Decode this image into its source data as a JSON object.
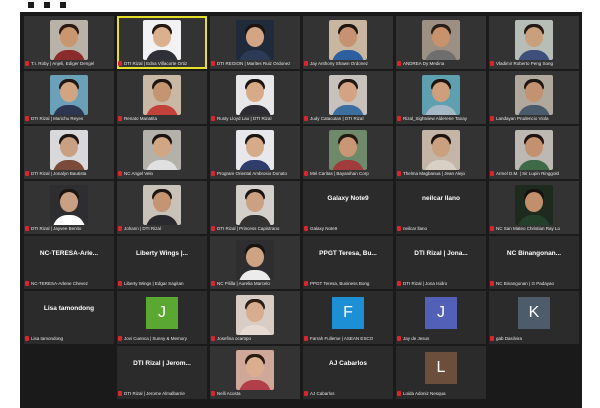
{
  "colors": {
    "active_border": "#e6df2a",
    "muted_mic": "#d8262e",
    "tile_bg": "#2b2b2b"
  },
  "icons": {
    "muted_mic": "mic-muted-icon"
  },
  "participants": [
    {
      "label": "T.I. Roby | Anjeli, Ediger Dengel",
      "type": "video",
      "photo": {
        "bg": "#b9b2a9",
        "skin": "#c9976f",
        "hair": "#2a1a12",
        "shirt": "#8a2c2c"
      }
    },
    {
      "label": "DTI Rizal | Edna Villacorte Ortiz",
      "type": "video",
      "active": true,
      "photo": {
        "bg": "#f2f2f4",
        "skin": "#dcb08f",
        "hair": "#241812",
        "shirt": "#2f2f38"
      }
    },
    {
      "label": "DTI REGION | Marites Ruiz Ordonez",
      "type": "video",
      "photo": {
        "bg": "#1f2a3a",
        "skin": "#d4a584",
        "hair": "#1c1410",
        "shirt": "#2b3b55"
      }
    },
    {
      "label": "Jay Anthony Shawn Ordonez",
      "type": "video",
      "photo": {
        "bg": "#c9b6a0",
        "skin": "#c69271",
        "hair": "#1e1511",
        "shirt": "#2d5fa0"
      }
    },
    {
      "label": "ANDREA Dy Medina",
      "type": "video",
      "photo": {
        "bg": "#9c8f84",
        "skin": "#c8926c",
        "hair": "#2a1f18",
        "shirt": "#6e6e6e"
      }
    },
    {
      "label": "Vladimir Roberto Peng Song",
      "type": "video",
      "photo": {
        "bg": "#b7beb8",
        "skin": "#caa07c",
        "hair": "#241a14",
        "shirt": "#3d4f7a"
      }
    },
    {
      "label": "DTI Rizal | Marichu Reyes",
      "type": "video",
      "photo": {
        "bg": "#6aa0b8",
        "skin": "#d2a582",
        "hair": "#201612",
        "shirt": "#2c3650"
      }
    },
    {
      "label": "Renato Manatita",
      "type": "video",
      "photo": {
        "bg": "#c8b8a4",
        "skin": "#c59470",
        "hair": "#1c140f",
        "shirt": "#c2423a"
      }
    },
    {
      "label": "Rusty Lloyd Lao | DTI Rizal",
      "type": "video",
      "photo": {
        "bg": "#e7e7ea",
        "skin": "#d8ab88",
        "hair": "#1c1410",
        "shirt": "#2c2c32"
      }
    },
    {
      "label": "Judy Catacutan | DTI Rizal",
      "type": "video",
      "photo": {
        "bg": "#c7c2bc",
        "skin": "#d3a384",
        "hair": "#211711",
        "shirt": "#3c6ea0"
      }
    },
    {
      "label": "Rizal_Sightview Alderene Tanay",
      "type": "video",
      "photo": {
        "bg": "#5e9fb0",
        "skin": "#cf9f7b",
        "hair": "#1d1410",
        "shirt": "#a4b8c6"
      }
    },
    {
      "label": "Landayan Prudencio Viola",
      "type": "video",
      "photo": {
        "bg": "#b0a79d",
        "skin": "#c39270",
        "hair": "#1f1611",
        "shirt": "#4a5a6b"
      }
    },
    {
      "label": "DTI Rizal | Jonalyn Bautista",
      "type": "video",
      "photo": {
        "bg": "#d9d9dc",
        "skin": "#caa083",
        "hair": "#1e1612",
        "shirt": "#7a4a3a"
      }
    },
    {
      "label": "NC Angel Velo",
      "type": "video",
      "photo": {
        "bg": "#b4b1ab",
        "skin": "#d1a684",
        "hair": "#1a1310",
        "shirt": "#e0e0e0"
      }
    },
    {
      "label": "Program Oriental Ambrosio Donato",
      "type": "video",
      "photo": {
        "bg": "#e8e8ec",
        "skin": "#d6ab8a",
        "hair": "#1d1512",
        "shirt": "#2e3e6a"
      }
    },
    {
      "label": "Mel Caritas | Bayanihan Corp",
      "type": "video",
      "photo": {
        "bg": "#6f8a6a",
        "skin": "#c99775",
        "hair": "#211812",
        "shirt": "#a13c3c"
      }
    },
    {
      "label": "Thelma Magbanua | Jean Alejo",
      "type": "video",
      "photo": {
        "bg": "#c4b5a6",
        "skin": "#caa07f",
        "hair": "#1c1410",
        "shirt": "#d8d0c4"
      }
    },
    {
      "label": "Armel D.M. | Sir Lupin Ringgold",
      "type": "video",
      "photo": {
        "bg": "#bdb9b2",
        "skin": "#c49170",
        "hair": "#1e1511",
        "shirt": "#3f6a48"
      }
    },
    {
      "label": "DTI Rizal | Jayvee Benito",
      "type": "video",
      "photo": {
        "bg": "#2e2e30",
        "skin": "#caa084",
        "hair": "#1b1410",
        "shirt": "#ffffff"
      }
    },
    {
      "label": "Johann | DTI Rizal",
      "type": "video",
      "photo": {
        "bg": "#c9c2b8",
        "skin": "#c59573",
        "hair": "#1d1511",
        "shirt": "#2a2a2e"
      }
    },
    {
      "label": "DTI Rizal | Princess Capistrano",
      "type": "video",
      "photo": {
        "bg": "#d3d0cb",
        "skin": "#cba083",
        "hair": "#1b1410",
        "shirt": "#323232"
      }
    },
    {
      "label": "Galaxy Note9",
      "type": "name",
      "name": "Galaxy Note9"
    },
    {
      "label": "neilcar llano",
      "type": "name",
      "name": "neilcar llano"
    },
    {
      "label": "NC San Mateo Christian Ray Lo",
      "type": "video",
      "photo": {
        "bg": "#1f2a1f",
        "skin": "#c28e6b",
        "hair": "#16110d",
        "shirt": "#23402a"
      }
    },
    {
      "label": "NC-TERESA-Arlene Chevez",
      "type": "name",
      "name": "NC-TERESA-Arle..."
    },
    {
      "label": "Liberty Wings | Edgar Sagitan",
      "type": "name",
      "name": "Liberty Wings |..."
    },
    {
      "label": "NC Pililla | Aurelia Marcelo",
      "type": "video",
      "photo": {
        "bg": "#2e2e30",
        "skin": "#cda384",
        "hair": "#19130f",
        "shirt": "#ececec"
      }
    },
    {
      "label": "PPGT Teresa, Business Bong",
      "type": "name",
      "name": "PPGT Teresa, Bu..."
    },
    {
      "label": "DTI Rizal | Jona Isidro",
      "type": "name",
      "name": "DTI Rizal | Jona..."
    },
    {
      "label": "NC Binangonan | G Padayao",
      "type": "name",
      "name": "NC Binangonan..."
    },
    {
      "label": "Lisa tamondong",
      "type": "name",
      "name": "Lisa tamondong"
    },
    {
      "label": "Jovi Cuenca | Sunny & Memory",
      "type": "initial",
      "initial": "J",
      "bg": "#5aa832"
    },
    {
      "label": "Josefina ocampo",
      "type": "video",
      "photo": {
        "bg": "#d8ccc4",
        "skin": "#d8ad8f",
        "hair": "#2a1e16",
        "shirt": "#e6dad2"
      }
    },
    {
      "label": "Farrah Fulleme | ASEAN ESCO",
      "type": "initial",
      "initial": "F",
      "bg": "#1d8fd4"
    },
    {
      "label": "Jay de Jesus",
      "type": "initial",
      "initial": "J",
      "bg": "#5360b8"
    },
    {
      "label": "gab Dasilvira",
      "type": "initial",
      "initial": "K",
      "bg": "#4d5b6a"
    },
    {
      "label": "",
      "type": "blank"
    },
    {
      "label": "DTI Rizal | Jerome Almalbarrie",
      "type": "name",
      "name": "DTI Rizal | Jerom..."
    },
    {
      "label": "Nelli Acosta",
      "type": "video",
      "photo": {
        "bg": "#cfa89a",
        "skin": "#dbae90",
        "hair": "#2b1a12",
        "shirt": "#b13e48"
      }
    },
    {
      "label": "AJ Cabarlos",
      "type": "name",
      "name": "AJ Cabarlos"
    },
    {
      "label": "Loida Adoniz Nesqua",
      "type": "initial",
      "initial": "L",
      "bg": "#6b4e3c"
    },
    {
      "label": "",
      "type": "blank"
    }
  ]
}
